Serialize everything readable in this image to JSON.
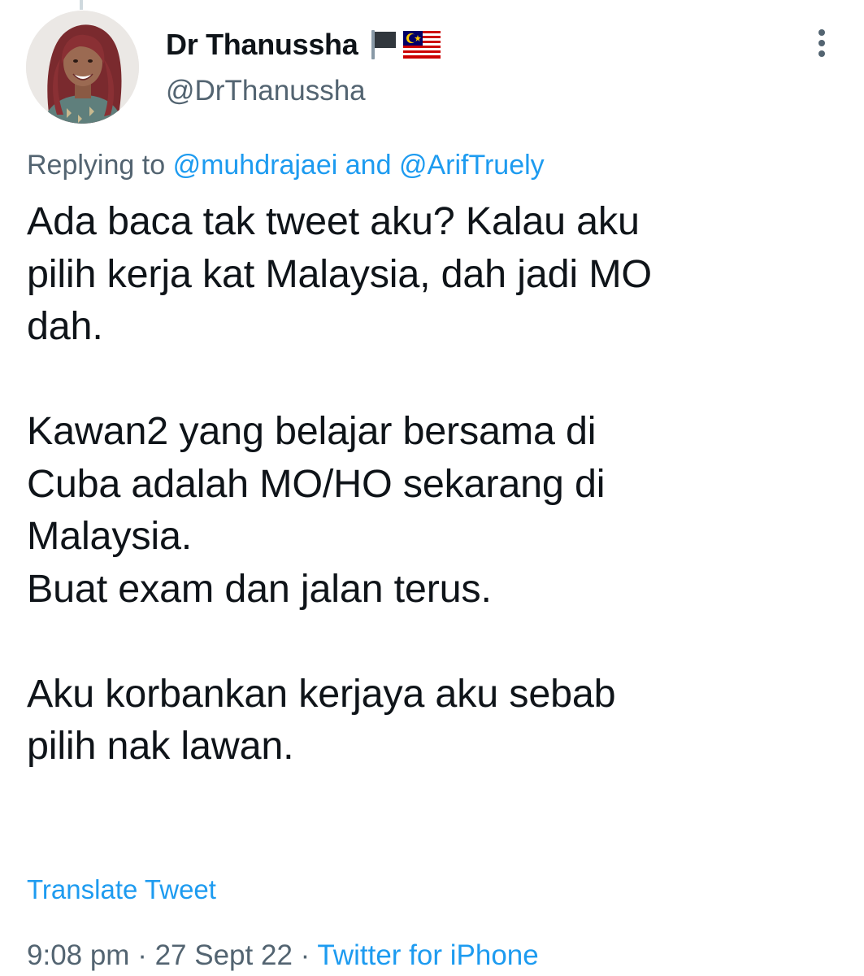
{
  "tweet": {
    "display_name": "Dr Thanussha",
    "handle": "@DrThanussha",
    "name_emojis": [
      "black-flag-icon",
      "malaysia-flag-icon"
    ],
    "replying_prefix": "Replying to",
    "reply_mention_1": "@muhdrajaei",
    "reply_joiner": "and",
    "reply_mention_2": "@ArifTruely",
    "text_lines": [
      "Ada baca tak tweet aku? Kalau aku",
      "pilih kerja kat Malaysia, dah jadi MO",
      "dah.",
      "",
      "Kawan2 yang belajar bersama di",
      "Cuba adalah MO/HO sekarang di",
      "Malaysia.",
      "Buat exam dan jalan terus.",
      "",
      "Aku korbankan kerjaya aku sebab",
      "pilih nak lawan."
    ],
    "translate_label": "Translate Tweet",
    "time": "9:08 pm",
    "date": "27 Sept 22",
    "separator": "·",
    "source": "Twitter for iPhone"
  },
  "colors": {
    "text_primary": "#0f1419",
    "text_secondary": "#536471",
    "accent": "#1d9bf0"
  }
}
